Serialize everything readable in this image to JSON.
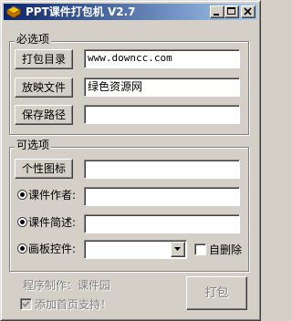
{
  "window": {
    "title": "PPT课件打包机 V2.7",
    "colors": {
      "titlebar_start": "#0a246a",
      "titlebar_end": "#a6caf0",
      "face": "#d4d0c8"
    }
  },
  "required_group": {
    "label": "必选项",
    "pack_dir_button": "打包目录",
    "pack_dir_value": "www.downcc.com",
    "player_file_button": "放映文件",
    "player_file_value": "绿色资源网",
    "save_path_button": "保存路径",
    "save_path_value": ""
  },
  "optional_group": {
    "label": "可选项",
    "icon_button": "个性图标",
    "icon_value": "",
    "author_label": "课件作者:",
    "author_value": "",
    "intro_label": "课件简述:",
    "intro_value": "",
    "board_label": "画板控件:",
    "board_selected": "",
    "auto_delete_label": "自删除"
  },
  "footer": {
    "credit": "程序制作：课件园",
    "add_homepage_label": "添加首页支持！",
    "pack_button": "打包"
  },
  "icons": {
    "app": "app-icon",
    "minimize": "minimize-icon",
    "maximize": "maximize-icon",
    "close": "close-icon",
    "dropdown": "chevron-down-icon",
    "check": "check-icon"
  }
}
